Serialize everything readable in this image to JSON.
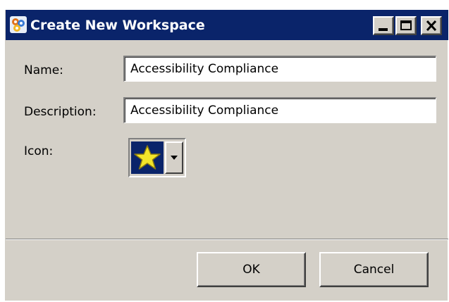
{
  "window": {
    "title": "Create New Workspace",
    "icon": "workspace-app-icon",
    "controls": [
      "minimize",
      "maximize",
      "close"
    ]
  },
  "form": {
    "name_label": "Name:",
    "name_value": "Accessibility Compliance",
    "description_label": "Description:",
    "description_value": "Accessibility Compliance",
    "icon_label": "Icon:",
    "icon_selected": "star-icon"
  },
  "buttons": {
    "ok_label": "OK",
    "cancel_label": "Cancel"
  },
  "colors": {
    "titlebar": "#0a246a",
    "dialog_face": "#d4d0c8",
    "star_fill": "#f2e52a"
  }
}
